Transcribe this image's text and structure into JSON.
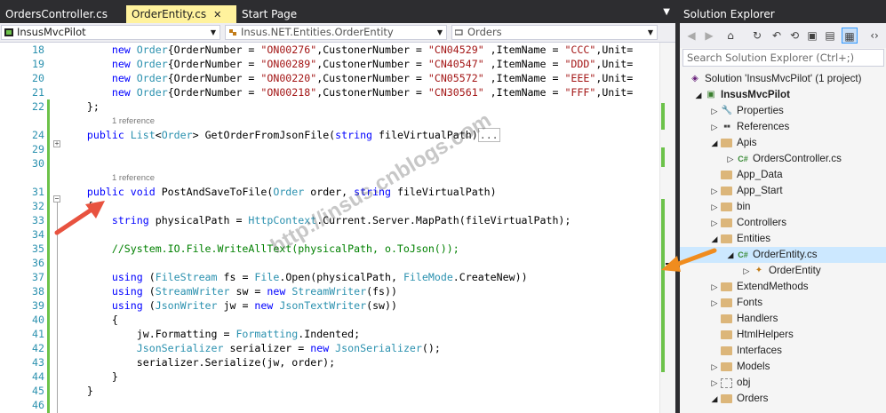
{
  "tabs": [
    {
      "label": "OrdersController.cs",
      "active": false
    },
    {
      "label": "OrderEntity.cs",
      "active": true
    },
    {
      "label": "Start Page",
      "active": false
    }
  ],
  "navbar": {
    "project": "InsusMvcPilot",
    "class": "Insus.NET.Entities.OrderEntity",
    "member": "Orders"
  },
  "code": {
    "lines": [
      {
        "num": "18",
        "html": "        <span class='kw'>new</span> <span class='ty'>Order</span>{OrderNumber = <span class='st'>\"ON00276\"</span>,CustonerNumber = <span class='st'>\"CN04529\"</span> ,ItemName = <span class='st'>\"CCC\"</span>,Unit="
      },
      {
        "num": "19",
        "html": "        <span class='kw'>new</span> <span class='ty'>Order</span>{OrderNumber = <span class='st'>\"ON00289\"</span>,CustonerNumber = <span class='st'>\"CN40547\"</span> ,ItemName = <span class='st'>\"DDD\"</span>,Unit="
      },
      {
        "num": "20",
        "html": "        <span class='kw'>new</span> <span class='ty'>Order</span>{OrderNumber = <span class='st'>\"ON00220\"</span>,CustonerNumber = <span class='st'>\"CN05572\"</span> ,ItemName = <span class='st'>\"EEE\"</span>,Unit="
      },
      {
        "num": "21",
        "html": "        <span class='kw'>new</span> <span class='ty'>Order</span>{OrderNumber = <span class='st'>\"ON00218\"</span>,CustonerNumber = <span class='st'>\"CN30561\"</span> ,ItemName = <span class='st'>\"FFF\"</span>,Unit="
      },
      {
        "num": "22",
        "html": "    };"
      },
      {
        "num": "",
        "ref": "1 reference"
      },
      {
        "num": "24",
        "html": "    <span class='kw'>public</span> <span class='ty'>List</span>&lt;<span class='ty'>Order</span>&gt; GetOrderFromJsonFile(<span class='kw'>string</span> fileVirtualPath)<span class='collapsed'>...</span>"
      },
      {
        "num": "29",
        "html": ""
      },
      {
        "num": "30",
        "html": ""
      },
      {
        "num": "",
        "ref": "1 reference"
      },
      {
        "num": "31",
        "html": "    <span class='kw'>public</span> <span class='kw'>void</span> PostAndSaveToFile(<span class='ty'>Order</span> order, <span class='kw'>string</span> fileVirtualPath)"
      },
      {
        "num": "32",
        "html": "    {"
      },
      {
        "num": "33",
        "html": "        <span class='kw'>string</span> physicalPath = <span class='ty'>HttpContext</span>.Current.Server.MapPath(fileVirtualPath);"
      },
      {
        "num": "34",
        "html": ""
      },
      {
        "num": "35",
        "html": "        <span class='cm'>//System.IO.File.WriteAllText(physicalPath, o.ToJson());</span>"
      },
      {
        "num": "36",
        "html": ""
      },
      {
        "num": "37",
        "html": "        <span class='kw'>using</span> (<span class='ty'>FileStream</span> fs = <span class='ty'>File</span>.Open(physicalPath, <span class='ty'>FileMode</span>.CreateNew))"
      },
      {
        "num": "38",
        "html": "        <span class='kw'>using</span> (<span class='ty'>StreamWriter</span> sw = <span class='kw'>new</span> <span class='ty'>StreamWriter</span>(fs))"
      },
      {
        "num": "39",
        "html": "        <span class='kw'>using</span> (<span class='ty'>JsonWriter</span> jw = <span class='kw'>new</span> <span class='ty'>JsonTextWriter</span>(sw))"
      },
      {
        "num": "40",
        "html": "        {"
      },
      {
        "num": "41",
        "html": "            jw.Formatting = <span class='ty'>Formatting</span>.Indented;"
      },
      {
        "num": "42",
        "html": "            <span class='ty'>JsonSerializer</span> serializer = <span class='kw'>new</span> <span class='ty'>JsonSerializer</span>();"
      },
      {
        "num": "43",
        "html": "            serializer.Serialize(jw, order);"
      },
      {
        "num": "44",
        "html": "        }"
      },
      {
        "num": "45",
        "html": "    }"
      },
      {
        "num": "46",
        "html": ""
      }
    ]
  },
  "solution_explorer": {
    "title": "Solution Explorer",
    "search_placeholder": "Search Solution Explorer (Ctrl+;)",
    "items": [
      {
        "label": "Solution 'InsusMvcPilot' (1 project)",
        "level": 0,
        "icon": "solution-icon",
        "exp": "",
        "bold": false
      },
      {
        "label": "InsusMvcPilot",
        "level": 1,
        "icon": "project-icon",
        "exp": "open",
        "bold": true
      },
      {
        "label": "Properties",
        "level": 2,
        "icon": "wrench-icon",
        "exp": "closed",
        "bold": false
      },
      {
        "label": "References",
        "level": 2,
        "icon": "references-icon",
        "exp": "closed",
        "bold": false
      },
      {
        "label": "Apis",
        "level": 2,
        "icon": "folder-icon",
        "exp": "open",
        "bold": false
      },
      {
        "label": "OrdersController.cs",
        "level": 3,
        "icon": "csharp-file-icon",
        "exp": "closed",
        "bold": false
      },
      {
        "label": "App_Data",
        "level": 2,
        "icon": "folder-icon",
        "exp": "",
        "bold": false
      },
      {
        "label": "App_Start",
        "level": 2,
        "icon": "folder-icon",
        "exp": "closed",
        "bold": false
      },
      {
        "label": "bin",
        "level": 2,
        "icon": "folder-icon",
        "exp": "closed",
        "bold": false
      },
      {
        "label": "Controllers",
        "level": 2,
        "icon": "folder-icon",
        "exp": "closed",
        "bold": false
      },
      {
        "label": "Entities",
        "level": 2,
        "icon": "folder-icon",
        "exp": "open",
        "bold": false
      },
      {
        "label": "OrderEntity.cs",
        "level": 3,
        "icon": "csharp-file-icon",
        "exp": "open",
        "bold": false,
        "selected": true
      },
      {
        "label": "OrderEntity",
        "level": 4,
        "icon": "class-icon",
        "exp": "closed",
        "bold": false
      },
      {
        "label": "ExtendMethods",
        "level": 2,
        "icon": "folder-icon",
        "exp": "closed",
        "bold": false
      },
      {
        "label": "Fonts",
        "level": 2,
        "icon": "folder-icon",
        "exp": "closed",
        "bold": false
      },
      {
        "label": "Handlers",
        "level": 2,
        "icon": "folder-icon",
        "exp": "",
        "bold": false
      },
      {
        "label": "HtmlHelpers",
        "level": 2,
        "icon": "folder-icon",
        "exp": "",
        "bold": false
      },
      {
        "label": "Interfaces",
        "level": 2,
        "icon": "folder-icon",
        "exp": "",
        "bold": false
      },
      {
        "label": "Models",
        "level": 2,
        "icon": "folder-icon",
        "exp": "closed",
        "bold": false
      },
      {
        "label": "obj",
        "level": 2,
        "icon": "dotted-folder-icon",
        "exp": "closed",
        "bold": false
      },
      {
        "label": "Orders",
        "level": 2,
        "icon": "folder-icon",
        "exp": "open",
        "bold": false
      }
    ]
  },
  "watermark": "http://insus.cnblogs.com",
  "colors": {
    "keyword": "#0000ff",
    "type": "#2b91af",
    "string": "#a31515",
    "comment": "#008000",
    "change_bar": "#6cc24a",
    "arrow": "#e8523f"
  }
}
